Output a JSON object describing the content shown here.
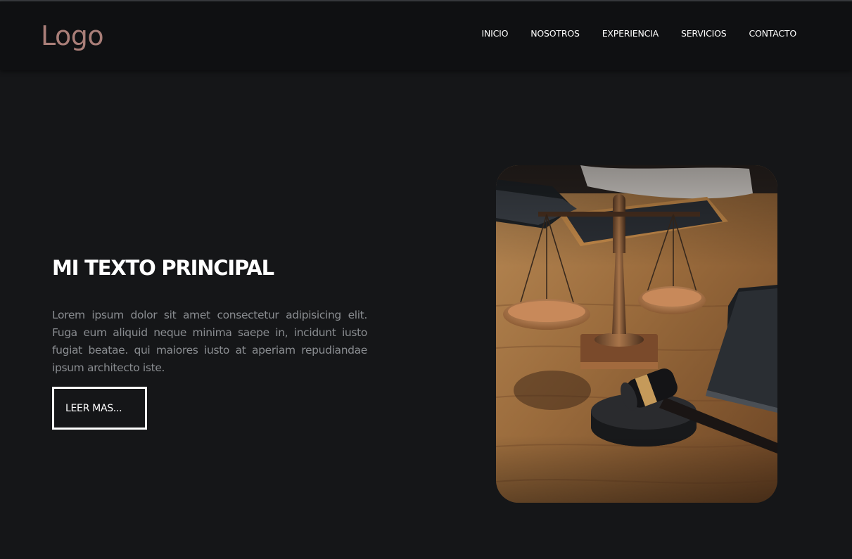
{
  "header": {
    "logo": "Logo",
    "nav": [
      "INICIO",
      "NOSOTROS",
      "EXPERIENCIA",
      "SERVICIOS",
      "CONTACTO"
    ]
  },
  "hero": {
    "title": "MI TEXTO PRINCIPAL",
    "text": "Lorem ipsum dolor sit amet consectetur adipisicing elit. Fuga eum aliquid neque minima saepe in, incidunt iusto fugiat beatae. qui maiores iusto at aperiam repudiandae ipsum architecto iste.",
    "button_label": "LEER MAS..."
  },
  "colors": {
    "background": "#151618",
    "header": "#0f1012",
    "logo": "#a97e78",
    "text_muted": "#8a8d91"
  },
  "image": {
    "subject": "scales-of-justice-and-gavel-photo"
  }
}
